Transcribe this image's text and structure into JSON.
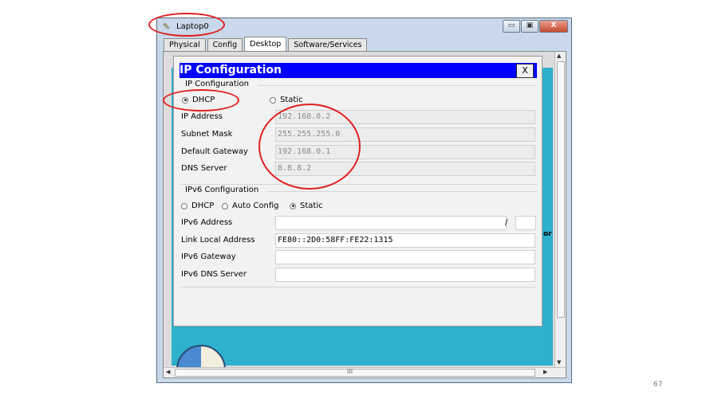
{
  "window": {
    "title": "Laptop0",
    "minimize": "▭",
    "maximize": "▣",
    "close": "X"
  },
  "tabs": [
    "Physical",
    "Config",
    "Desktop",
    "Software/Services"
  ],
  "active_tab": "Desktop",
  "dialog": {
    "title": "IP Configuration",
    "close": "X",
    "ipv4": {
      "section": "IP Configuration",
      "mode_options": [
        "DHCP",
        "Static"
      ],
      "mode_selected": "DHCP",
      "fields": [
        {
          "label": "IP Address",
          "value": "192.168.0.2"
        },
        {
          "label": "Subnet Mask",
          "value": "255.255.255.0"
        },
        {
          "label": "Default Gateway",
          "value": "192.168.0.1"
        },
        {
          "label": "DNS Server",
          "value": "8.8.8.2"
        }
      ]
    },
    "ipv6": {
      "section": "IPv6 Configuration",
      "mode_options": [
        "DHCP",
        "Auto Config",
        "Static"
      ],
      "mode_selected": "Static",
      "fields": [
        {
          "label": "IPv6 Address",
          "value": "",
          "suffix": "/"
        },
        {
          "label": "Link Local Address",
          "value": "FE80::2D0:58FF:FE22:1315"
        },
        {
          "label": "IPv6 Gateway",
          "value": ""
        },
        {
          "label": "IPv6 DNS Server",
          "value": ""
        }
      ]
    }
  },
  "background_partial_text": "or",
  "scroll_grip": "III",
  "page_number": "67",
  "colors": {
    "dialog_title": "#0000ff",
    "annotation": "#e02020",
    "desktop": "#2fb0cc"
  }
}
